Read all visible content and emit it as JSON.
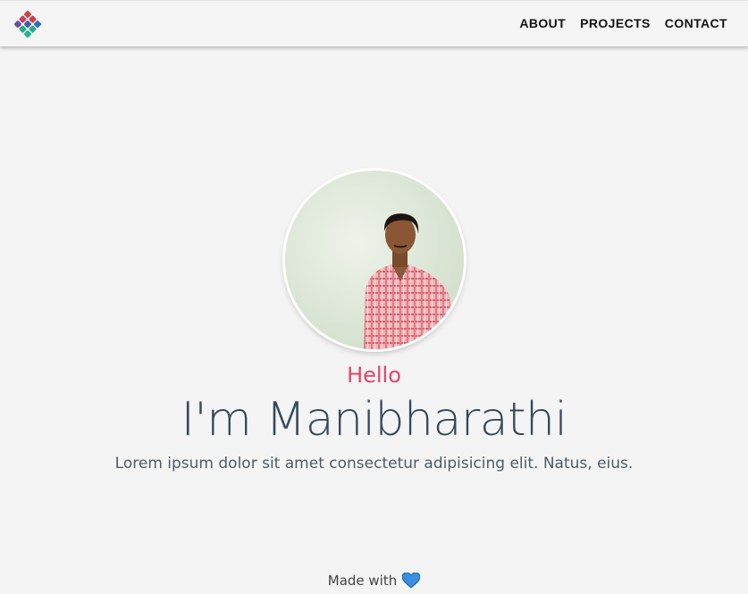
{
  "nav": {
    "logo_icon": "diamond-grid-logo-icon",
    "links": [
      "ABOUT",
      "PROJECTS",
      "CONTACT"
    ]
  },
  "hero": {
    "greeting": "Hello",
    "name": "I'm Manibharathi",
    "tagline": "Lorem ipsum dolor sit amet consectetur adipisicing elit. Natus, eius."
  },
  "footer": {
    "made_with": "Made with",
    "heart_icon": "heart-icon"
  },
  "colors": {
    "greeting": "#e54466",
    "name": "#35495e",
    "heart": "#3c8fe0",
    "background": "#f4f4f4"
  }
}
